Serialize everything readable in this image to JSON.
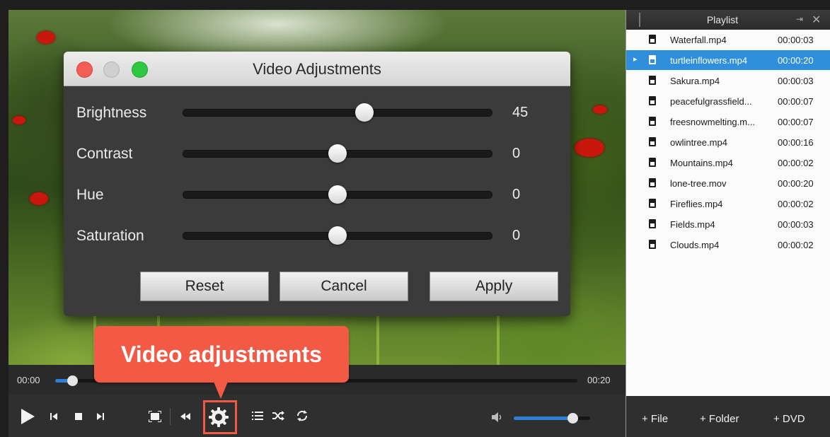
{
  "dialog": {
    "title": "Video Adjustments",
    "sliders": [
      {
        "label": "Brightness",
        "value": "45",
        "position": 0.6
      },
      {
        "label": "Contrast",
        "value": "0",
        "position": 0.5
      },
      {
        "label": "Hue",
        "value": "0",
        "position": 0.5
      },
      {
        "label": "Saturation",
        "value": "0",
        "position": 0.5
      }
    ],
    "buttons": {
      "reset": "Reset",
      "cancel": "Cancel",
      "apply": "Apply"
    }
  },
  "player": {
    "time_current": "00:00",
    "time_total": "00:20",
    "progress": 0.02,
    "volume": 0.77
  },
  "callout": {
    "text": "Video adjustments"
  },
  "playlist": {
    "title": "Playlist",
    "items": [
      {
        "name": "Waterfall.mp4",
        "duration": "00:00:03"
      },
      {
        "name": "turtleinflowers.mp4",
        "duration": "00:00:20"
      },
      {
        "name": "Sakura.mp4",
        "duration": "00:00:03"
      },
      {
        "name": "peacefulgrassfield...",
        "duration": "00:00:07"
      },
      {
        "name": "freesnowmelting.m...",
        "duration": "00:00:07"
      },
      {
        "name": "owlintree.mp4",
        "duration": "00:00:16"
      },
      {
        "name": "Mountains.mp4",
        "duration": "00:00:02"
      },
      {
        "name": "lone-tree.mov",
        "duration": "00:00:20"
      },
      {
        "name": "Fireflies.mp4",
        "duration": "00:00:02"
      },
      {
        "name": "Fields.mp4",
        "duration": "00:00:03"
      },
      {
        "name": "Clouds.mp4",
        "duration": "00:00:02"
      }
    ],
    "footer": {
      "file": "+ File",
      "folder": "+ Folder",
      "dvd": "+ DVD"
    }
  },
  "colors": {
    "accent": "#2f8fdc",
    "callout": "#f25a45"
  }
}
